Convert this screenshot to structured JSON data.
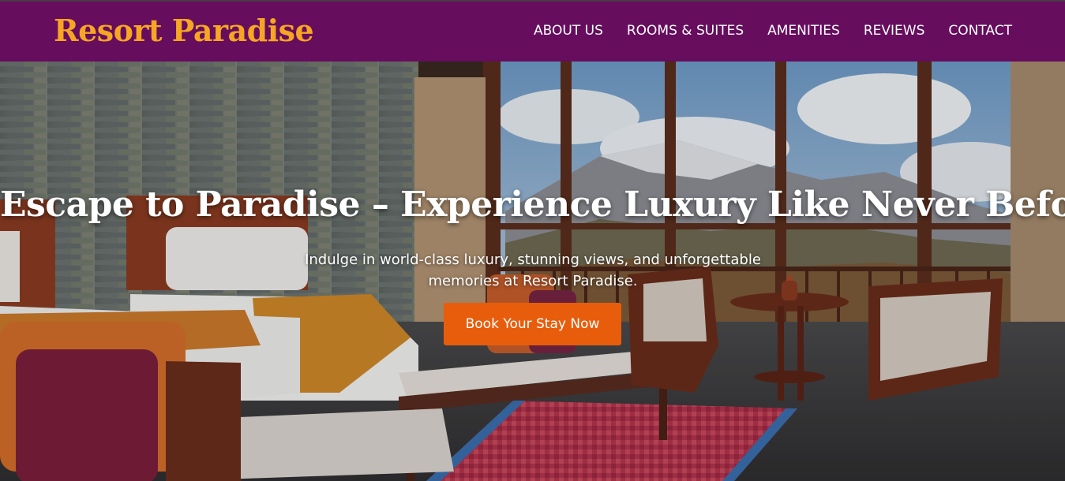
{
  "brand": {
    "name": "Resort Paradise",
    "color": "#f6a623"
  },
  "header": {
    "background": "#660d5e"
  },
  "nav": {
    "items": [
      {
        "label": "ABOUT US"
      },
      {
        "label": "ROOMS & SUITES"
      },
      {
        "label": "AMENITIES"
      },
      {
        "label": "REVIEWS"
      },
      {
        "label": "CONTACT"
      }
    ]
  },
  "hero": {
    "headline": "Escape to Paradise – Experience Luxury Like Never Before",
    "subtext": "Indulge in world-class luxury, stunning views, and unforgettable memories at Resort Paradise.",
    "cta_label": "Book Your Stay Now",
    "cta_color": "#e85d0c",
    "background_image": "hotel-room-with-mountain-view"
  }
}
